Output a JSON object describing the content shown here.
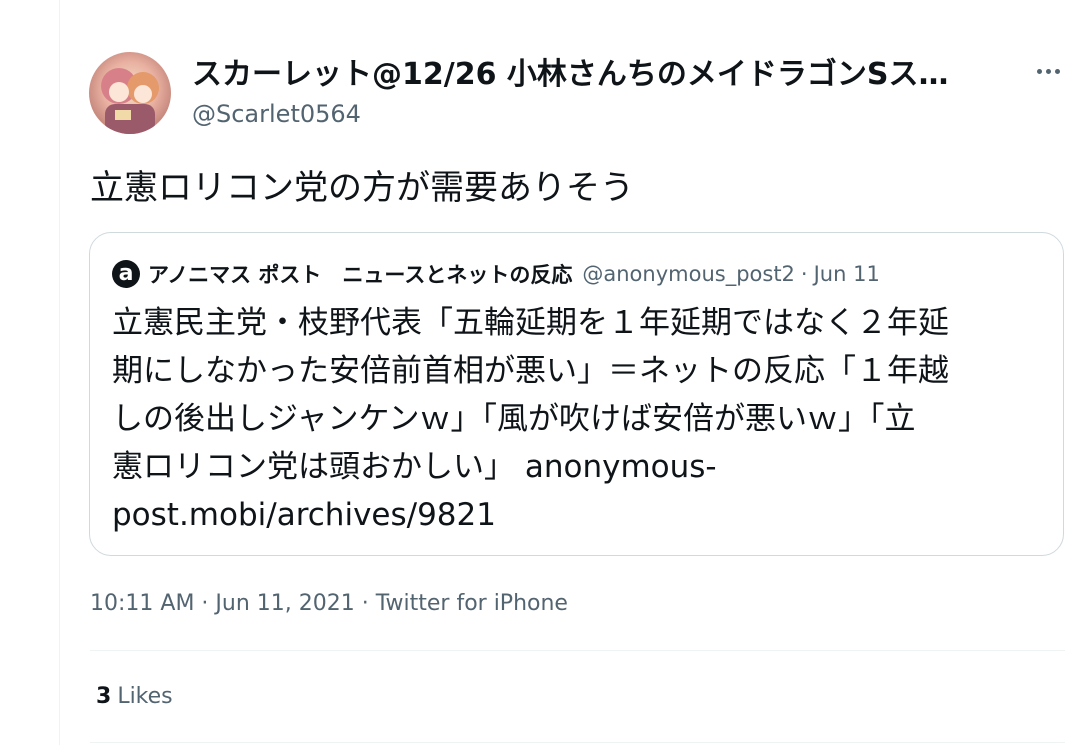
{
  "tweet": {
    "display_name": "スカーレット@12/26 小林さんちのメイドラゴンSス…",
    "handle": "@Scarlet0564",
    "avatar_icon": "user-avatar",
    "more_icon": "more-horizontal-icon",
    "text": "立憲ロリコン党の方が需要ありそう",
    "quote": {
      "avatar_letter": "a",
      "name": "アノニマス ポスト　ニュースとネットの反応",
      "handle": "@anonymous_post2",
      "separator": "·",
      "date": "Jun 11",
      "body": "立憲民主党・枝野代表「五輪延期を１年延期ではなく２年延\n期にしなかった安倍前首相が悪い」＝ネットの反応「１年越\nしの後出しジャンケンｗ」「風が吹けば安倍が悪いｗ」「立\n憲ロリコン党は頭おかしい」 anonymous-\npost.mobi/archives/9821"
    },
    "timestamp": "10:11 AM · Jun 11, 2021 · Twitter for iPhone",
    "likes": {
      "count": "3",
      "label": "Likes"
    }
  },
  "colors": {
    "text": "#0f1419",
    "secondary": "#536471",
    "border": "#cfd9de",
    "divider": "#eff3f4"
  }
}
